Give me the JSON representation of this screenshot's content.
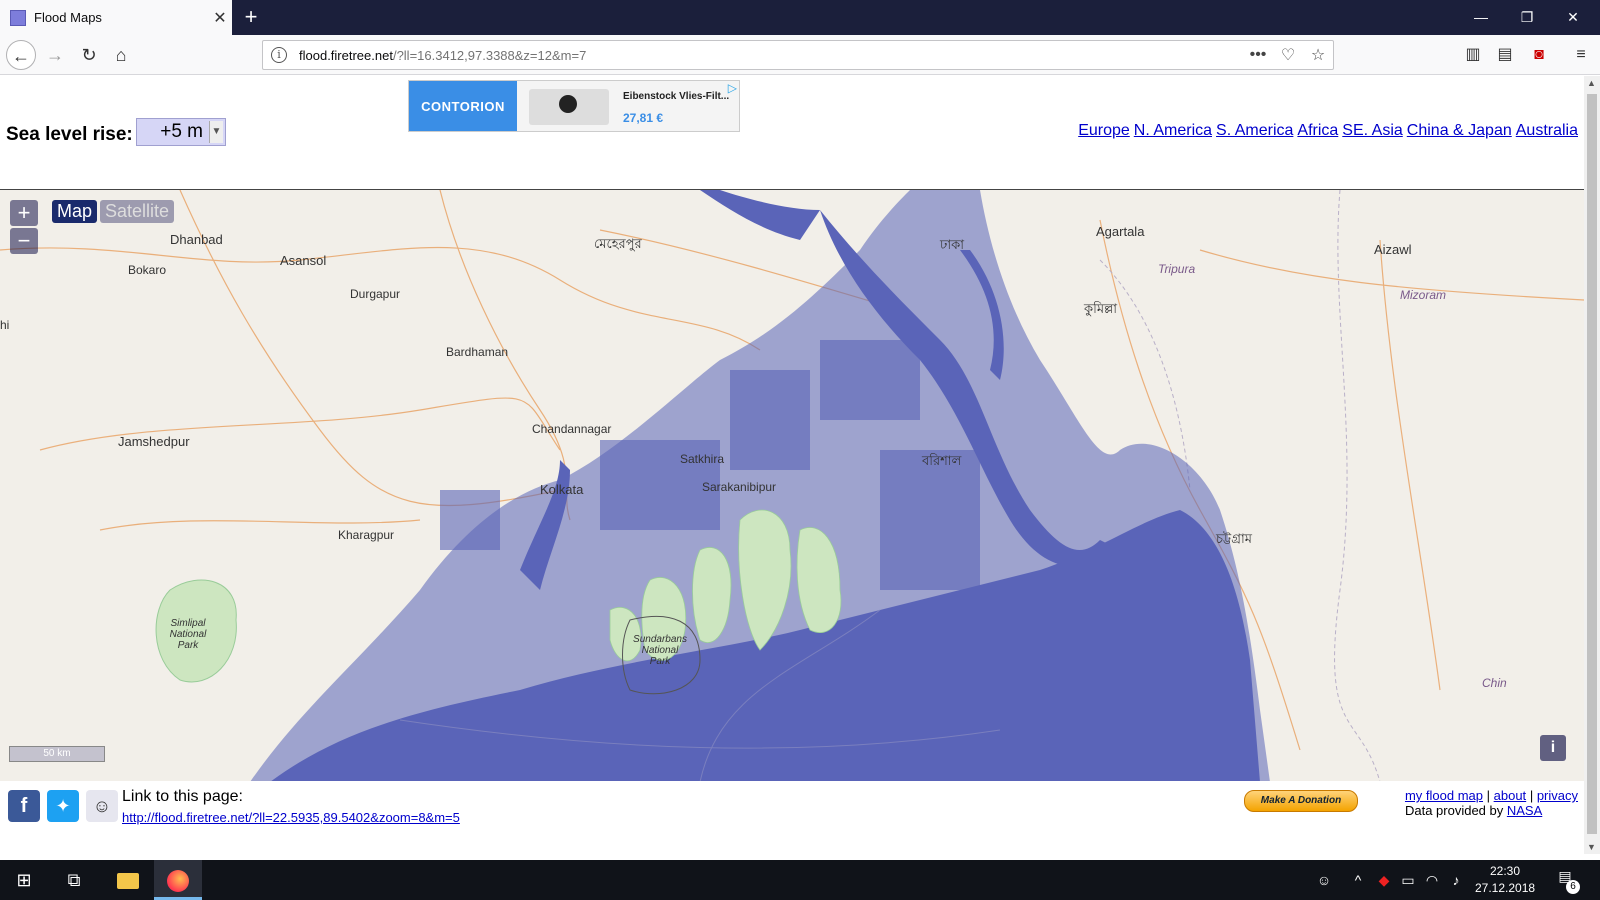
{
  "browser": {
    "tab_title": "Flood Maps",
    "url_domain": "flood.firetree.net",
    "url_rest": "/?ll=16.3412,97.3388&z=12&m=7"
  },
  "header": {
    "sea_level_label": "Sea level rise:",
    "sea_level_value": "+5 m",
    "regions": [
      "Europe",
      "N. America",
      "S. America",
      "Africa",
      "SE. Asia",
      "China & Japan",
      "Australia"
    ]
  },
  "ad": {
    "brand": "CONTORION",
    "product": "Eibenstock Vlies-Filt...",
    "price": "27,81 €"
  },
  "map": {
    "map_button": "Map",
    "satellite_button": "Satellite",
    "scale": "50 km",
    "labels": [
      {
        "text": "Dhanbad",
        "cls": "big"
      },
      {
        "text": "Bokaro",
        "cls": ""
      },
      {
        "text": "Asansol",
        "cls": "big"
      },
      {
        "text": "Durgapur",
        "cls": ""
      },
      {
        "text": "মেহেরপুর",
        "cls": "big"
      },
      {
        "text": "Bardhaman",
        "cls": ""
      },
      {
        "text": "Agartala",
        "cls": "big"
      },
      {
        "text": "Aizawl",
        "cls": "big"
      },
      {
        "text": "Tripura",
        "cls": ""
      },
      {
        "text": "Mizoram",
        "cls": ""
      },
      {
        "text": "কুমিল্লা",
        "cls": "big"
      },
      {
        "text": "ঢাকা",
        "cls": "big"
      },
      {
        "text": "Jamshedpur",
        "cls": "big"
      },
      {
        "text": "Chandannagar",
        "cls": ""
      },
      {
        "text": "Satkhira",
        "cls": ""
      },
      {
        "text": "Kolkata",
        "cls": "big"
      },
      {
        "text": "Sarakanibipur",
        "cls": ""
      },
      {
        "text": "বরিশাল",
        "cls": "big"
      },
      {
        "text": "Kharagpur",
        "cls": ""
      },
      {
        "text": "চট্টগ্রাম",
        "cls": "big"
      },
      {
        "text": "Simlipal National Park",
        "cls": ""
      },
      {
        "text": "Sundarbans National Park",
        "cls": ""
      },
      {
        "text": "Chin",
        "cls": ""
      },
      {
        "text": "hi",
        "cls": ""
      }
    ]
  },
  "footer": {
    "link_title": "Link to this page:",
    "link_url": "http://flood.firetree.net/?ll=22.5935,89.5402&zoom=8&m=5",
    "donate": "Make A Donation",
    "my_flood_map": "my flood map",
    "about": "about",
    "privacy": "privacy",
    "data_provided": "Data provided by",
    "nasa": "NASA"
  },
  "taskbar": {
    "time": "22:30",
    "date": "27.12.2018",
    "notifications": "6"
  },
  "colors": {
    "flood": "#5a64b8",
    "land": "#f2efe9",
    "park": "#cde6c0"
  }
}
